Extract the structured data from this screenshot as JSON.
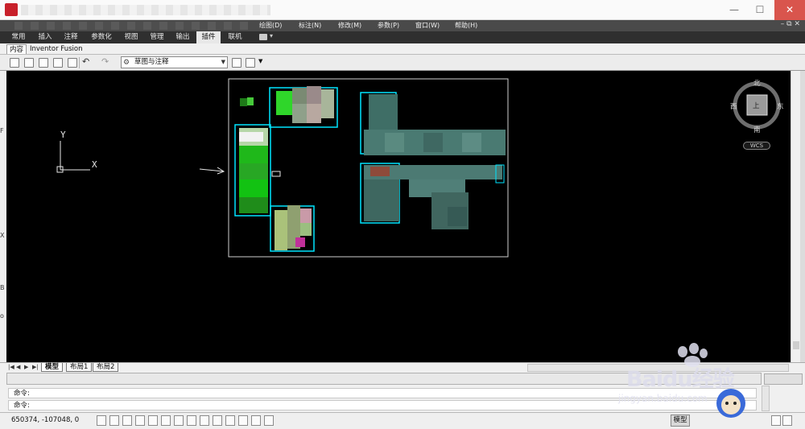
{
  "menubar": {
    "items": [
      "绘图(D)",
      "标注(N)",
      "修改(M)",
      "参数(P)",
      "窗口(W)",
      "帮助(H)"
    ]
  },
  "ribbon": {
    "tabs": [
      "常用",
      "插入",
      "注释",
      "参数化",
      "视图",
      "管理",
      "输出",
      "插件",
      "联机"
    ],
    "active_tab": "插件"
  },
  "panel_tabs": [
    "内容",
    "Inventor Fusion"
  ],
  "toolbar": {
    "workspace": "草图与注释"
  },
  "viewcube": {
    "north": "北",
    "south": "南",
    "east": "东",
    "west": "西",
    "center": "上",
    "wcs_label": "WCS"
  },
  "ucs": {
    "x_label": "X",
    "y_label": "Y"
  },
  "layout_tabs": [
    "模型",
    "布局1",
    "布局2"
  ],
  "command": {
    "line1": "命令:",
    "line2": "命令:"
  },
  "status": {
    "coordinates": "650374, -107048, 0",
    "model_button": "模型"
  },
  "watermark": {
    "brand": "Baidu经验",
    "url": "jingyan.baidu.com"
  },
  "colors": {
    "canvas": "#000000",
    "cyan_border": "#00e5ff",
    "close_button": "#d9554d",
    "ribbon_bg": "#2f2f2f",
    "menu_bg": "#4a4a4a"
  }
}
